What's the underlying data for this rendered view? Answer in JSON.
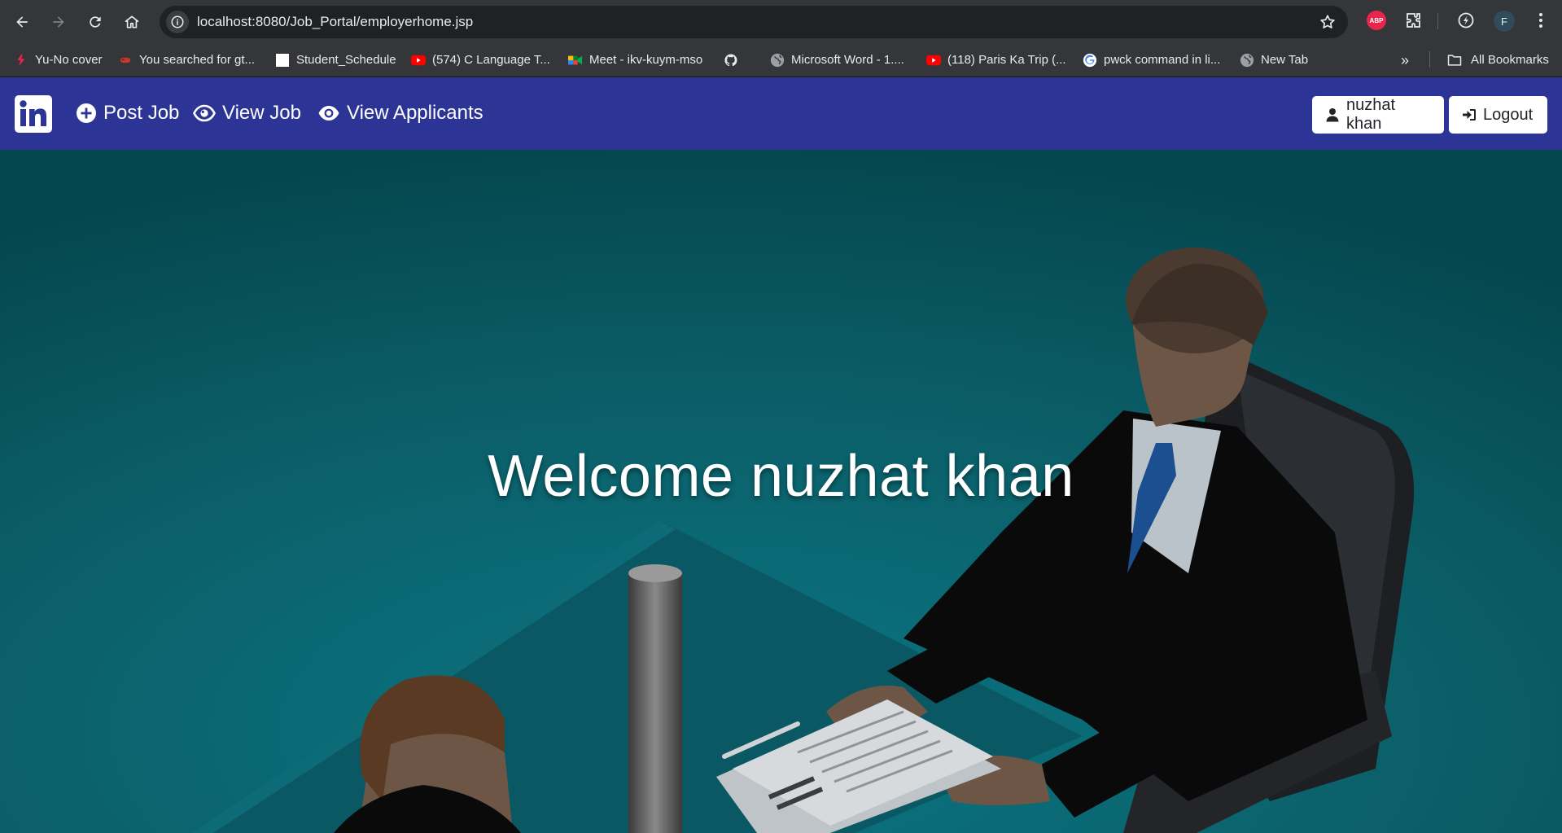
{
  "browser": {
    "url": "localhost:8080/Job_Portal/employerhome.jsp",
    "profile_initial": "F",
    "abp_label": "ABP",
    "bookmarks": [
      {
        "label": "Yu-No cover",
        "icon": "bookmark-favicon-icon"
      },
      {
        "label": "You searched for gt...",
        "icon": "bookmark-favicon-icon"
      },
      {
        "label": "Student_Schedule",
        "icon": "blank-page-icon"
      },
      {
        "label": "(574) C Language T...",
        "icon": "youtube-icon"
      },
      {
        "label": "Meet - ikv-kuym-mso",
        "icon": "google-meet-icon"
      },
      {
        "label": "",
        "icon": "github-icon"
      },
      {
        "label": "Microsoft Word - 1....",
        "icon": "globe-icon"
      },
      {
        "label": "(118) Paris Ka Trip (...",
        "icon": "youtube-icon"
      },
      {
        "label": "pwck command in li...",
        "icon": "google-icon"
      },
      {
        "label": "New Tab",
        "icon": "globe-icon"
      }
    ],
    "more_label": "»",
    "all_bookmarks_label": "All Bookmarks"
  },
  "navbar": {
    "brand_icon": "linkedin-icon",
    "links": [
      {
        "label": "Post Job",
        "icon": "plus-circle-icon"
      },
      {
        "label": "View Job",
        "icon": "eye-icon"
      },
      {
        "label": "View Applicants",
        "icon": "eye-icon"
      }
    ],
    "user_label": "nuzhat khan",
    "logout_label": "Logout"
  },
  "hero": {
    "title": "Welcome nuzhat khan"
  },
  "colors": {
    "navbar": "#2c3595",
    "hero_background": "#0c5f67",
    "chrome_toolbar": "#35363a"
  }
}
